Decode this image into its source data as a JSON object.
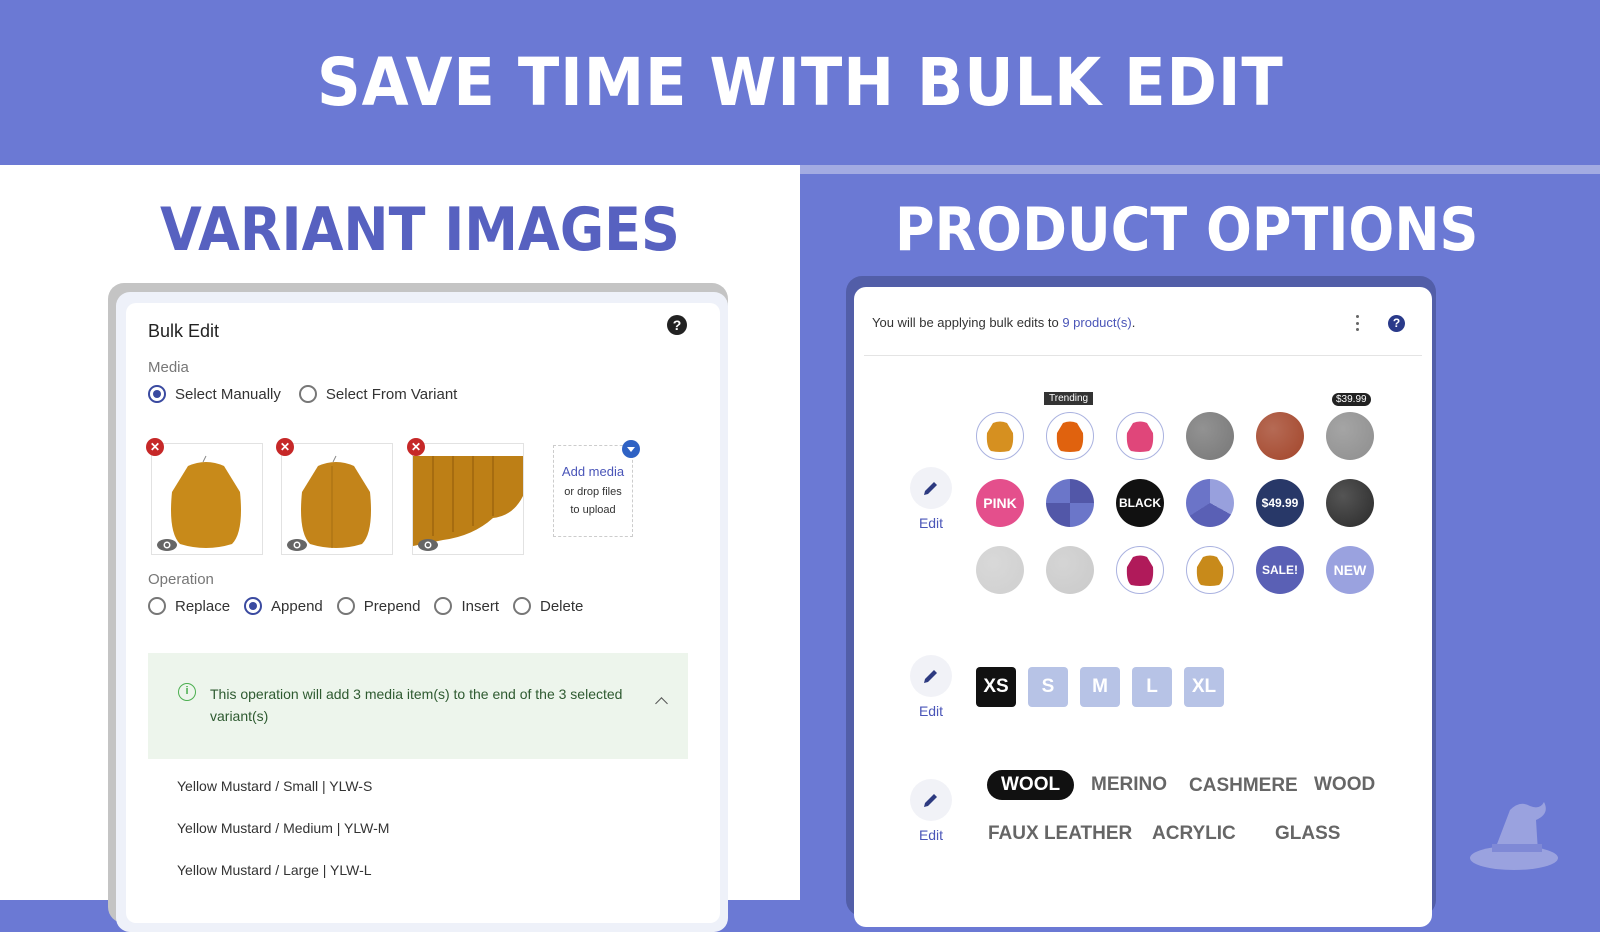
{
  "banner": {
    "title": "SAVE TIME WITH BULK EDIT"
  },
  "left": {
    "section_title": "VARIANT IMAGES",
    "card": {
      "title": "Bulk Edit",
      "help_icon": "help-circle-icon",
      "media_label": "Media",
      "media_options": [
        {
          "label": "Select Manually",
          "selected": true
        },
        {
          "label": "Select From Variant",
          "selected": false
        }
      ],
      "media_items": [
        {
          "name": "mustard-cardigan-front",
          "color": "#c88a1a"
        },
        {
          "name": "mustard-cardigan-open",
          "color": "#c3841a"
        },
        {
          "name": "mustard-fabric-closeup",
          "color": "#bd7f16"
        }
      ],
      "add_media": {
        "link": "Add media",
        "sub1": "or drop files",
        "sub2": "to upload"
      },
      "operation_label": "Operation",
      "operations": [
        {
          "label": "Replace",
          "selected": false
        },
        {
          "label": "Append",
          "selected": true
        },
        {
          "label": "Prepend",
          "selected": false
        },
        {
          "label": "Insert",
          "selected": false
        },
        {
          "label": "Delete",
          "selected": false
        }
      ],
      "info_text": "This operation will add 3 media item(s) to the end of the 3 selected variant(s)",
      "variants": [
        "Yellow Mustard / Small | YLW-S",
        "Yellow Mustard / Medium | YLW-M",
        "Yellow Mustard / Large | YLW-L"
      ]
    }
  },
  "right": {
    "section_title": "PRODUCT OPTIONS",
    "card": {
      "header_prefix": "You will be applying bulk edits to ",
      "header_link": "9 product(s)",
      "header_suffix": ".",
      "edit_label": "Edit",
      "swatch_rows": [
        [
          {
            "type": "image",
            "name": "mustard-top",
            "color": "#d69020"
          },
          {
            "type": "image",
            "name": "orange-top",
            "color": "#e0620e",
            "badge": "Trending"
          },
          {
            "type": "image",
            "name": "pink-top",
            "color": "#e0467a"
          },
          {
            "type": "texture",
            "name": "gray-croc",
            "color": "#777777"
          },
          {
            "type": "texture",
            "name": "red-croc",
            "color": "#a3452a"
          },
          {
            "type": "texture",
            "name": "leopard",
            "color": "#8e8e8e",
            "price_badge": "$39.99"
          }
        ],
        [
          {
            "type": "text",
            "name": "pink",
            "label": "PINK",
            "color": "#e44f8c"
          },
          {
            "type": "quad",
            "name": "purple-quad",
            "color": "#5a60b5"
          },
          {
            "type": "text",
            "name": "black",
            "label": "BLACK",
            "color": "#111111"
          },
          {
            "type": "tri",
            "name": "purple-tri",
            "color": "#6b74c8"
          },
          {
            "type": "text",
            "name": "price",
            "label": "$49.99",
            "color": "#283868"
          },
          {
            "type": "texture",
            "name": "black-leather",
            "color": "#2a2a2a"
          }
        ],
        [
          {
            "type": "texture",
            "name": "red-bracelet",
            "color": "#cfcfcf"
          },
          {
            "type": "texture",
            "name": "red-bracelet-2",
            "color": "#cacaca"
          },
          {
            "type": "image",
            "name": "magenta-necklace",
            "color": "#b01a5a"
          },
          {
            "type": "image",
            "name": "mustard-necklace",
            "color": "#c88a1a"
          },
          {
            "type": "text",
            "name": "sale",
            "label": "SALE!",
            "color": "#5a60b5"
          },
          {
            "type": "text",
            "name": "new",
            "label": "NEW",
            "color": "#9aa2df"
          }
        ]
      ],
      "sizes": [
        {
          "label": "XS",
          "selected": true
        },
        {
          "label": "S",
          "selected": false
        },
        {
          "label": "M",
          "selected": false
        },
        {
          "label": "L",
          "selected": false
        },
        {
          "label": "XL",
          "selected": false
        }
      ],
      "materials": [
        {
          "label": "WOOL",
          "selected": true
        },
        {
          "label": "MERINO",
          "selected": false
        },
        {
          "label": "CASHMERE",
          "selected": false
        },
        {
          "label": "WOOD",
          "selected": false
        },
        {
          "label": "FAUX LEATHER",
          "selected": false
        },
        {
          "label": "ACRYLIC",
          "selected": false
        },
        {
          "label": "GLASS",
          "selected": false
        }
      ]
    }
  },
  "colors": {
    "brand": "#6b79d4",
    "accent_dark": "#5761c0",
    "link": "#4a55b8"
  }
}
